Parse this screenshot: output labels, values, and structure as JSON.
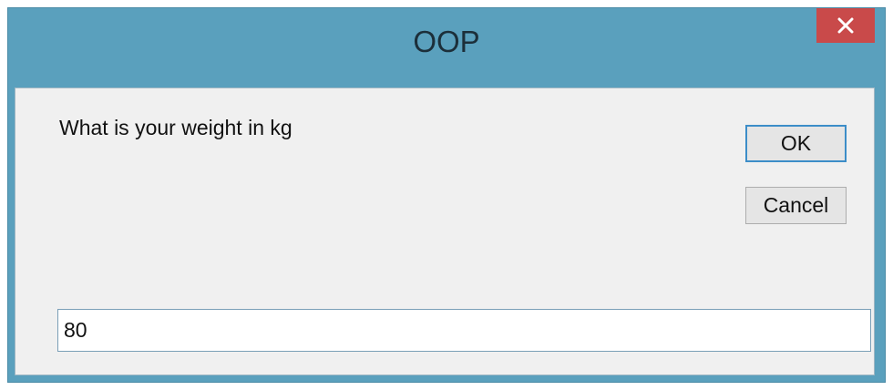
{
  "window": {
    "title": "OOP",
    "close_icon": "close-icon",
    "close_color": "#c94a4a",
    "titlebar_color": "#5aa0bd"
  },
  "dialog": {
    "prompt": "What is your weight in kg",
    "ok_label": "OK",
    "cancel_label": "Cancel",
    "input_value": "80"
  }
}
